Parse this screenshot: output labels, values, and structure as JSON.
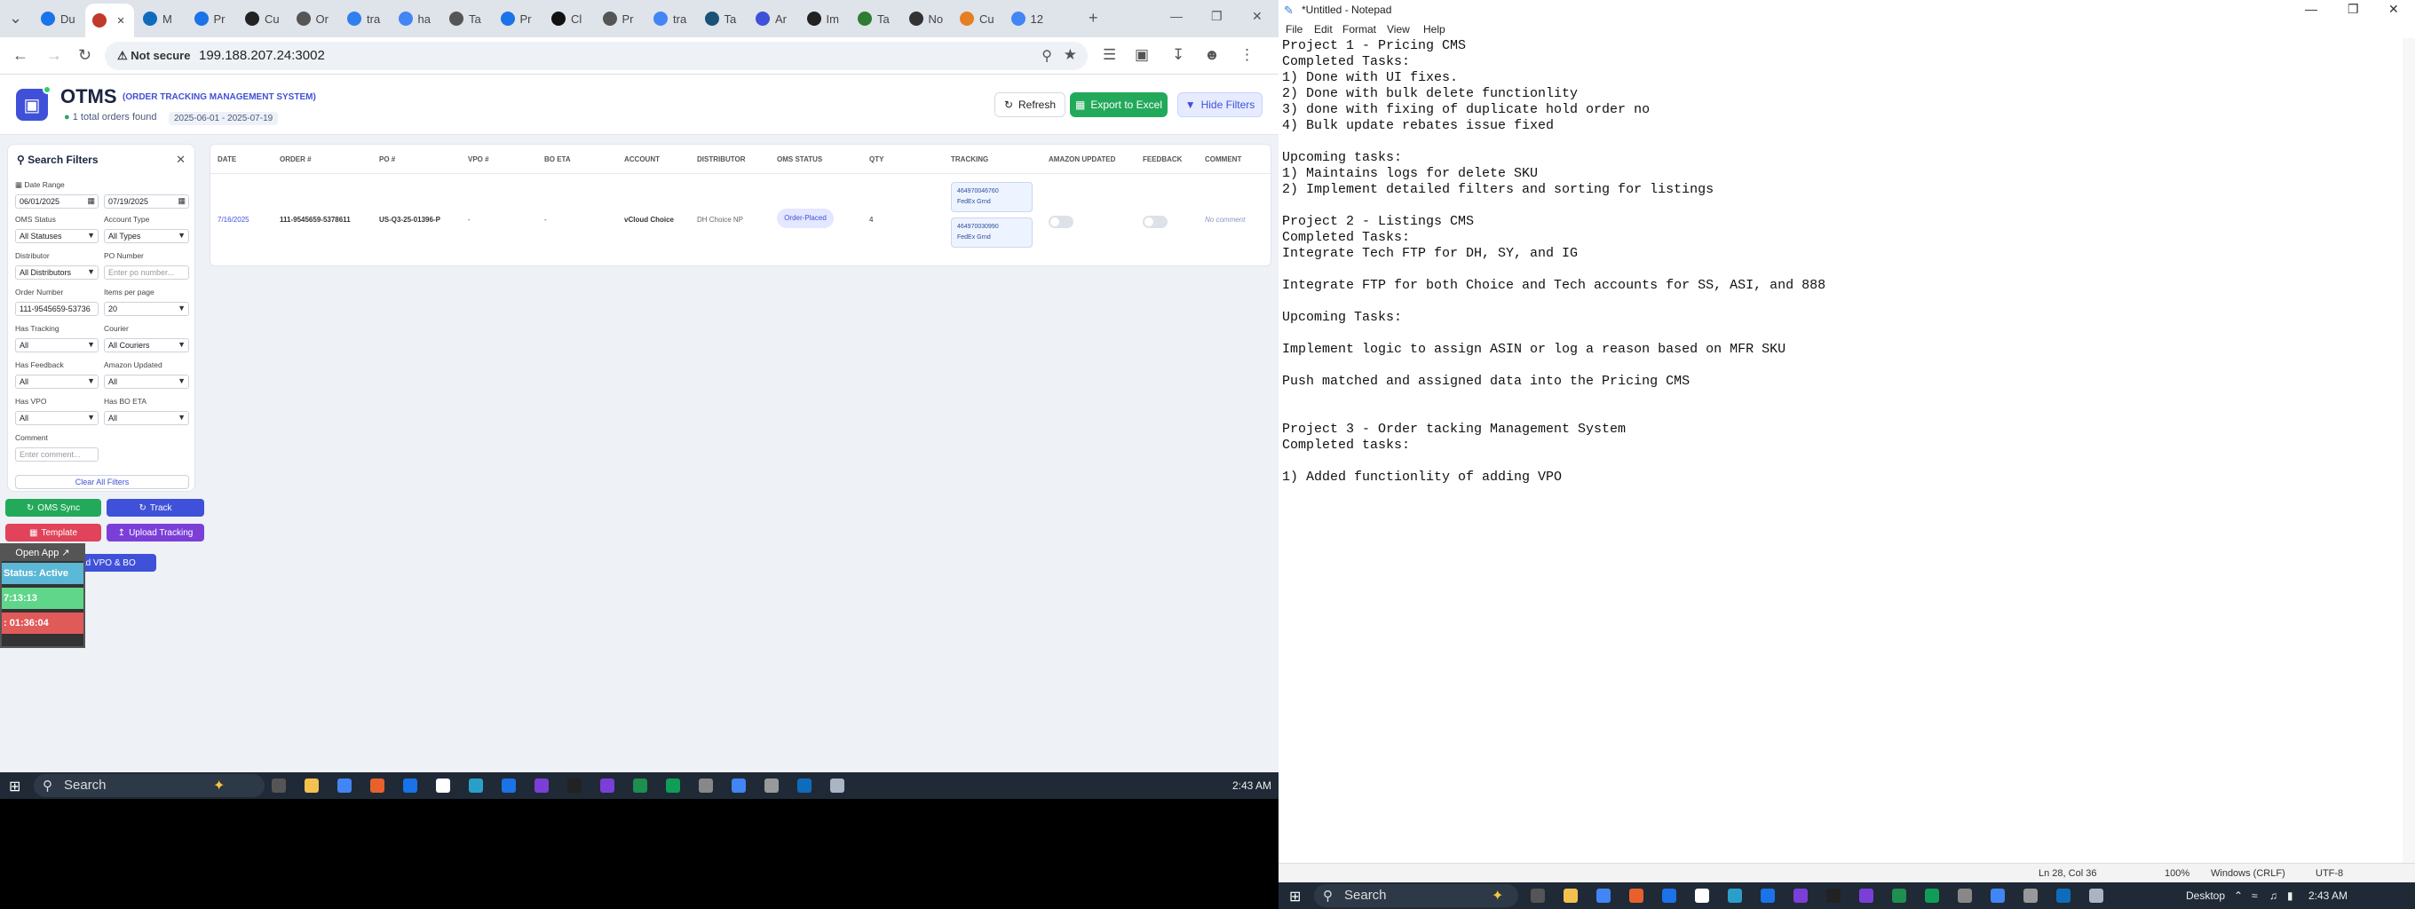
{
  "browser": {
    "tabs": [
      {
        "label": "Du",
        "color": "#1a73e8",
        "icon": "edge-icon"
      },
      {
        "label": "",
        "color": "#c0392b",
        "icon": "car-icon"
      },
      {
        "label": "M",
        "color": "#0f6cbd",
        "icon": "outlook-icon"
      },
      {
        "label": "Pr",
        "color": "#1a73e8",
        "icon": "s-icon"
      },
      {
        "label": "Cu",
        "color": "#222222",
        "icon": "c-icon"
      },
      {
        "label": "Or",
        "color": "#555555",
        "icon": "globe-icon"
      },
      {
        "label": "tra",
        "color": "#2f80ed",
        "icon": "wave-icon"
      },
      {
        "label": "ha",
        "color": "#4285f4",
        "icon": "google-icon"
      },
      {
        "label": "Ta",
        "color": "#555555",
        "icon": "globe-icon"
      },
      {
        "label": "Pr",
        "color": "#1a73e8",
        "icon": "s-icon"
      },
      {
        "label": "Cl",
        "color": "#111111",
        "icon": "ai-icon"
      },
      {
        "label": "Pr",
        "color": "#555555",
        "icon": "globe-icon"
      },
      {
        "label": "tra",
        "color": "#4285f4",
        "icon": "google-icon"
      },
      {
        "label": "Ta",
        "color": "#1a5276",
        "icon": "pen-icon"
      },
      {
        "label": "Ar",
        "color": "#3f51d8",
        "icon": "arrow-icon"
      },
      {
        "label": "Im",
        "color": "#222222",
        "icon": "info-icon"
      },
      {
        "label": "Ta",
        "color": "#2e7d32",
        "icon": "glasses-icon"
      },
      {
        "label": "No",
        "color": "#333333",
        "icon": "globe-icon"
      },
      {
        "label": "Cu",
        "color": "#e67e22",
        "icon": "v-icon"
      },
      {
        "label": "12",
        "color": "#4285f4",
        "icon": "google-icon"
      }
    ],
    "new_tab": "+",
    "not_secure": "Not secure",
    "url": "199.188.207.24:3002"
  },
  "app": {
    "title": "OTMS",
    "subtitle": "(ORDER TRACKING MANAGEMENT SYSTEM)",
    "orders_found": "1 total orders found",
    "date_range_badge": "2025-06-01 - 2025-07-19",
    "refresh": "Refresh",
    "export": "Export to Excel",
    "hide_filters": "Hide Filters",
    "accent": "#3f51d8"
  },
  "filters": {
    "title": "Search Filters",
    "date_range_label": "Date Range",
    "date_from": "06/01/2025",
    "date_to": "07/19/2025",
    "oms_status_label": "OMS Status",
    "oms_status": "All Statuses",
    "account_type_label": "Account Type",
    "account_type": "All Types",
    "distributor_label": "Distributor",
    "distributor": "All Distributors",
    "po_number_label": "PO Number",
    "po_number_placeholder": "Enter po number...",
    "order_number_label": "Order Number",
    "order_number": "111-9545659-53736",
    "items_per_page_label": "Items per page",
    "items_per_page": "20",
    "has_tracking_label": "Has Tracking",
    "has_tracking": "All",
    "courier_label": "Courier",
    "courier": "All Couriers",
    "has_feedback_label": "Has Feedback",
    "has_feedback": "All",
    "amazon_updated_label": "Amazon Updated",
    "amazon_updated": "All",
    "has_vpo_label": "Has VPO",
    "has_vpo": "All",
    "has_bo_eta_label": "Has BO ETA",
    "has_bo_eta": "All",
    "comment_label": "Comment",
    "comment_placeholder": "Enter comment...",
    "clear_all": "Clear All Filters"
  },
  "actions": {
    "oms_sync": "OMS Sync",
    "track": "Track",
    "template": "Template",
    "upload_tracking": "Upload Tracking",
    "upload_vpo": "load VPO & BO"
  },
  "overlay": {
    "open_app": "Open App ↗",
    "status": "Status: Active",
    "time1": "7:13:13",
    "time2": ": 01:36:04"
  },
  "table": {
    "headers": [
      "DATE",
      "ORDER #",
      "PO #",
      "VPO #",
      "BO ETA",
      "ACCOUNT",
      "DISTRIBUTOR",
      "OMS STATUS",
      "QTY",
      "TRACKING",
      "AMAZON UPDATED",
      "FEEDBACK",
      "COMMENT"
    ],
    "row": {
      "date": "7/16/2025",
      "order": "111-9545659-5378611",
      "po": "US-Q3-25-01396-P",
      "vpo": "-",
      "bo_eta": "-",
      "account": "vCloud Choice",
      "distributor": "DH Choice NP",
      "oms_status": "Order-Placed",
      "qty": "4",
      "tracking": [
        {
          "number": "464970046760",
          "courier": "FedEx Grnd"
        },
        {
          "number": "464970030990",
          "courier": "FedEx Grnd"
        }
      ],
      "comment": "No comment"
    }
  },
  "taskbar_left": {
    "search": "Search",
    "time": "2:43 AM"
  },
  "notepad": {
    "title": "*Untitled - Notepad",
    "menu": [
      "File",
      "Edit",
      "Format",
      "View",
      "Help"
    ],
    "lines": [
      "Project 1 - Pricing CMS",
      "Completed Tasks:",
      "1) Done with UI fixes.",
      "2) Done with bulk delete functionlity",
      "3) done with fixing of duplicate hold order no",
      "4) Bulk update rebates issue fixed",
      "",
      "Upcoming tasks:",
      "1) Maintains logs for delete SKU",
      "2) Implement detailed filters and sorting for listings",
      "",
      "Project 2 - Listings CMS",
      "Completed Tasks:",
      "Integrate Tech FTP for DH, SY, and IG",
      "",
      "Integrate FTP for both Choice and Tech accounts for SS, ASI, and 888",
      "",
      "Upcoming Tasks:",
      "",
      "Implement logic to assign ASIN or log a reason based on MFR SKU",
      "",
      "Push matched and assigned data into the Pricing CMS",
      "",
      "",
      "Project 3 - Order tacking Management System",
      "Completed tasks:",
      "",
      "1) Added functionlity of adding VPO"
    ],
    "status_pos": "Ln 28, Col 36",
    "status_zoom": "100%",
    "status_eol": "Windows (CRLF)",
    "status_enc": "UTF-8"
  },
  "taskbar_right": {
    "search": "Search",
    "desktop": "Desktop",
    "time": "2:43 AM"
  }
}
